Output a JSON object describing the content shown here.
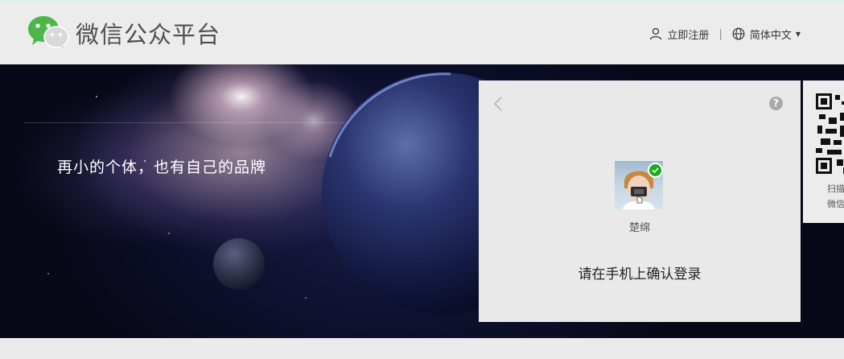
{
  "header": {
    "brand": "微信公众平台",
    "register_label": "立即注册",
    "separator": "|",
    "language_label": "简体中文",
    "icons": {
      "logo": "wechat-logo",
      "register": "user-icon",
      "language": "globe-icon",
      "language_caret": "caret-down-icon"
    }
  },
  "banner": {
    "slogan": "再小的个体，也有自己的品牌"
  },
  "login_panel": {
    "nickname": "楚绵",
    "confirm_text": "请在手机上确认登录",
    "icons": {
      "back": "chevron-left-icon",
      "help": "question-icon",
      "verified": "check-icon"
    },
    "help_glyph": "?"
  },
  "side_card": {
    "line1": "扫描",
    "line2": "微信"
  },
  "colors": {
    "brand_green": "#1aad19",
    "header_bg": "#ececec",
    "panel_bg": "#e9e9e9",
    "banner_dark": "#0d0f2c"
  }
}
